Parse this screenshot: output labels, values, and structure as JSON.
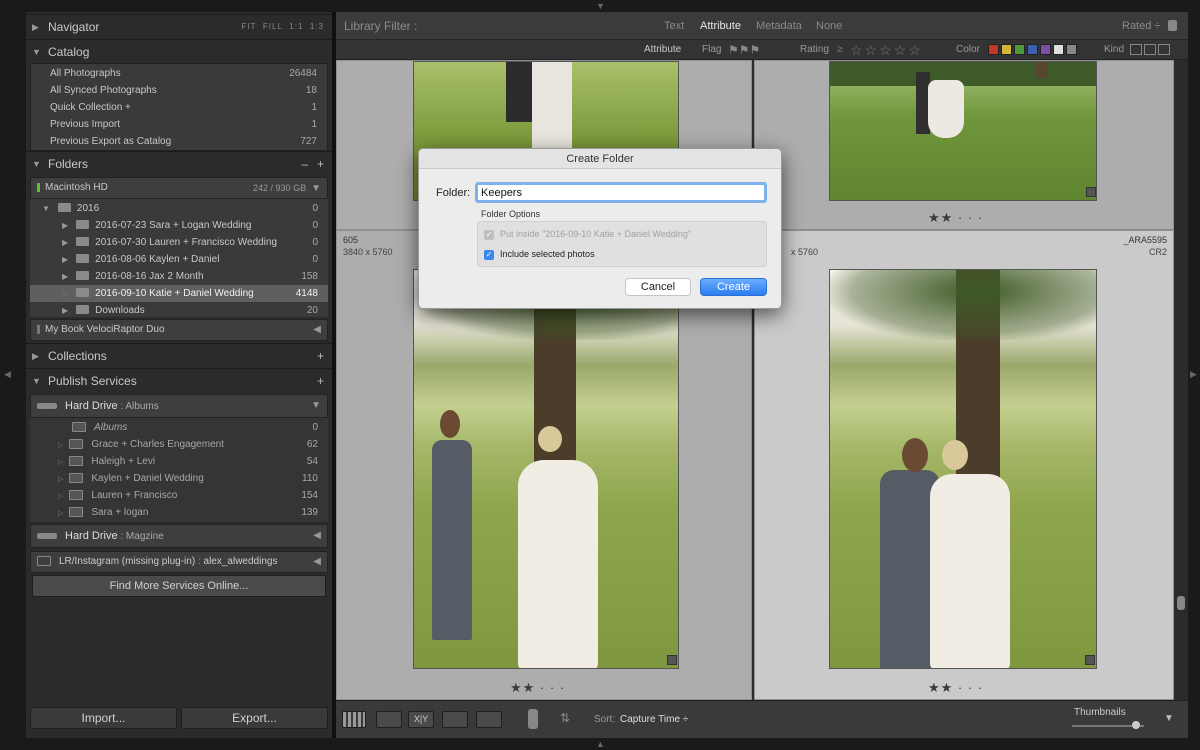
{
  "left_panel": {
    "navigator": {
      "title": "Navigator",
      "modes": [
        "FIT",
        "FILL",
        "1:1",
        "1:3"
      ]
    },
    "catalog": {
      "title": "Catalog",
      "items": [
        {
          "label": "All Photographs",
          "count": "26484"
        },
        {
          "label": "All Synced Photographs",
          "count": "18"
        },
        {
          "label": "Quick Collection +",
          "count": "1"
        },
        {
          "label": "Previous Import",
          "count": "1"
        },
        {
          "label": "Previous Export as Catalog",
          "count": "727"
        }
      ]
    },
    "folders": {
      "title": "Folders",
      "actions": [
        "–",
        "+"
      ],
      "volume": {
        "name": "Macintosh HD",
        "space": "242 / 930 GB"
      },
      "items": [
        {
          "label": "2016",
          "count": "0"
        },
        {
          "label": "2016-07-23 Sara + Logan Wedding",
          "count": "0"
        },
        {
          "label": "2016-07-30 Lauren + Francisco Wedding",
          "count": "0"
        },
        {
          "label": "2016-08-06 Kaylen + Daniel",
          "count": "0"
        },
        {
          "label": "2016-08-16 Jax 2 Month",
          "count": "158"
        },
        {
          "label": "2016-09-10 Katie + Daniel Wedding",
          "count": "4148"
        },
        {
          "label": "Downloads",
          "count": "20"
        }
      ],
      "volume2": {
        "name": "My Book VelociRaptor Duo"
      }
    },
    "collections": {
      "title": "Collections",
      "action": "+"
    },
    "publish": {
      "title": "Publish Services",
      "action": "+",
      "service1": {
        "name": "Hard Drive",
        "sub": "Albums"
      },
      "items": [
        {
          "label": "Albums",
          "count": "0"
        },
        {
          "label": "Grace + Charles Engagement",
          "count": "62"
        },
        {
          "label": "Haleigh + Levi",
          "count": "54"
        },
        {
          "label": "Kaylen + Daniel Wedding",
          "count": "110"
        },
        {
          "label": "Lauren + Francisco",
          "count": "154"
        },
        {
          "label": "Sara + logan",
          "count": "139"
        }
      ],
      "service2": {
        "name": "Hard Drive",
        "sub": "Magzine"
      },
      "service3": {
        "name": "LR/Instagram (missing plug-in)",
        "sub": "alex_alweddings"
      },
      "find_more": "Find More Services Online..."
    },
    "import_label": "Import...",
    "export_label": "Export..."
  },
  "filter_bar": {
    "title": "Library Filter :",
    "tabs": [
      "Text",
      "Attribute",
      "Metadata",
      "None"
    ],
    "active_tab": "Attribute",
    "rated": "Rated ÷",
    "attr_label": "Attribute",
    "flag_label": "Flag",
    "rating_label": "Rating",
    "rating_op": "≥",
    "color_label": "Color",
    "kind_label": "Kind",
    "colors": [
      "#c0392b",
      "#d4b73a",
      "#4e9a3a",
      "#3c5fb0",
      "#7b4fa8",
      "#dddddd",
      "#888888"
    ]
  },
  "grid": {
    "cells": [
      {
        "stars": "★★ · · ·"
      },
      {
        "stars": "★★ · · ·"
      },
      {
        "number": "605",
        "dims": "3840 x 5760",
        "stars": "★★ · · ·"
      },
      {
        "dims": "x 5760",
        "filename": "_ARA5595",
        "ext": "CR2",
        "stars": "★★ · · ·"
      }
    ]
  },
  "toolbar": {
    "sort_label": "Sort:",
    "sort_value": "Capture Time ÷",
    "thumbnails_label": "Thumbnails"
  },
  "dialog": {
    "title": "Create Folder",
    "folder_label": "Folder:",
    "folder_value": "Keepers",
    "options_title": "Folder Options",
    "put_inside": "Put inside \"2016-09-10 Katie + Daniel Wedding\"",
    "include_selected": "Include selected photos",
    "cancel": "Cancel",
    "create": "Create"
  }
}
